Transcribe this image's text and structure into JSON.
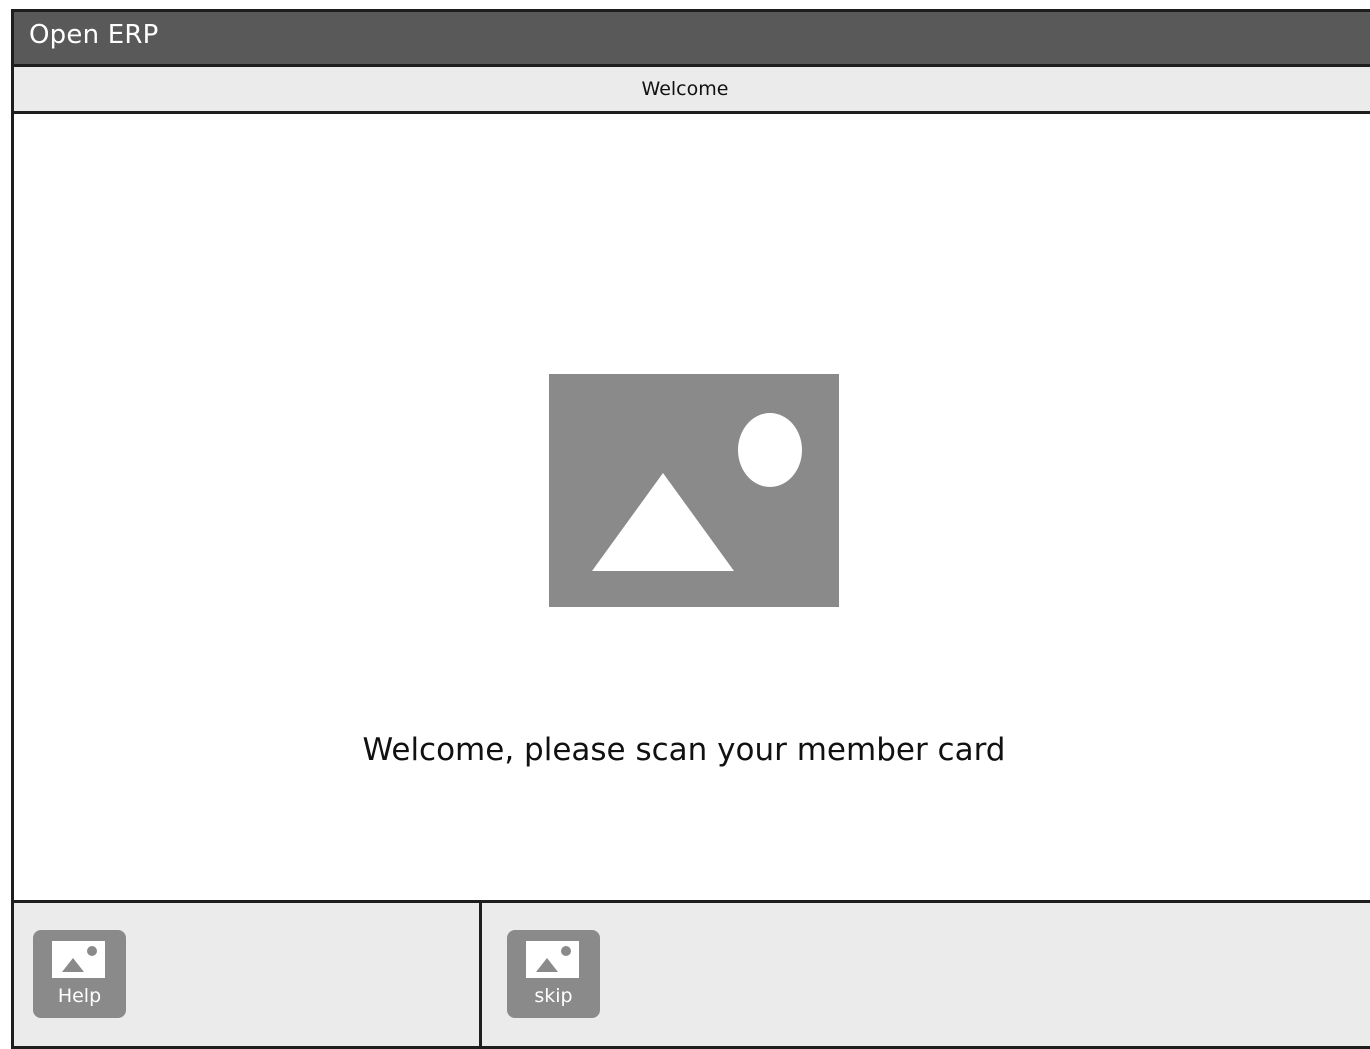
{
  "app": {
    "title": "Open ERP"
  },
  "header": {
    "title": "Welcome"
  },
  "main": {
    "image_icon": "image-placeholder-icon",
    "message": "Welcome, please scan your member card"
  },
  "footer": {
    "buttons": [
      {
        "label": "Help",
        "icon": "image-placeholder-icon"
      },
      {
        "label": "skip",
        "icon": "image-placeholder-icon"
      }
    ]
  },
  "colors": {
    "titlebar": "#595959",
    "subheader": "#ebebeb",
    "footer": "#ebebeb",
    "placeholder": "#8a8a8a",
    "border": "#1e1e1e"
  }
}
